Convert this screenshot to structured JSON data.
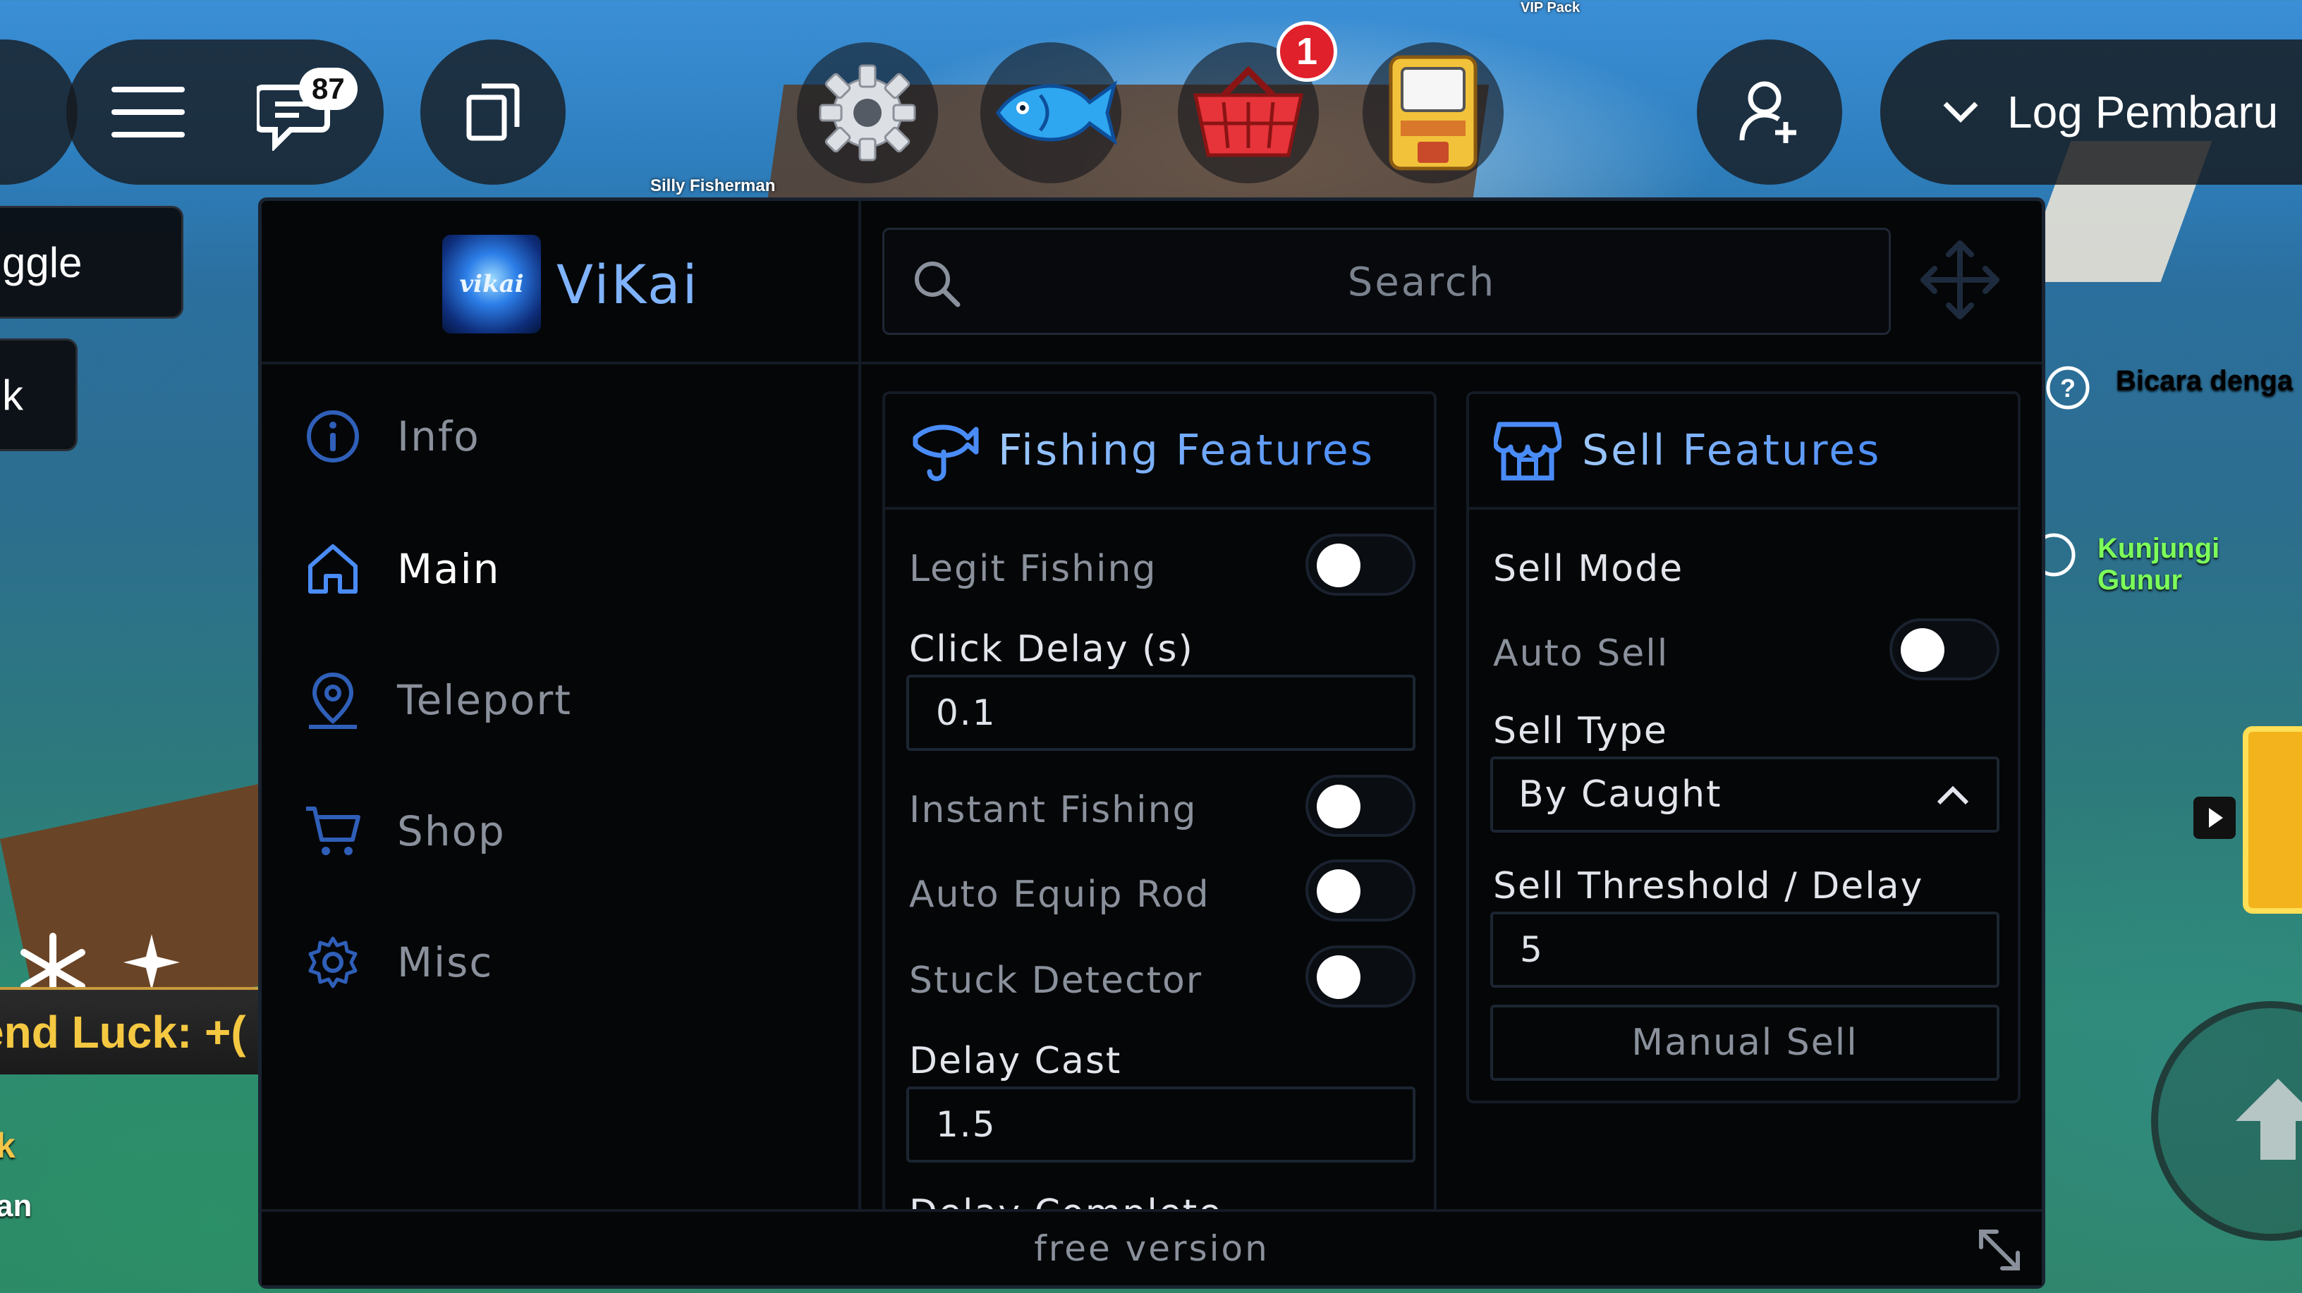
{
  "top_bar": {
    "chat_badge": "87",
    "shop_badge": "1",
    "log_button_label": "Log Pembaru",
    "npc_label": "Silly Fisherman",
    "vip_label": "VIP Pack"
  },
  "left_side": {
    "toggle_fragment": "ggle",
    "second_fragment": "k",
    "luck_text": "end Luck: +(",
    "frag_1": "k",
    "frag_2": "an"
  },
  "right_side": {
    "hint_1": "Bicara denga",
    "hint_2": "Kunjungi Gunur",
    "hint_1_color": "#ffffff",
    "hint_2_color": "#7dff5a"
  },
  "panel": {
    "brand_logo_text": "vikai",
    "brand_name": "ViKai",
    "search_placeholder": "Search",
    "nav": [
      {
        "label": "Info",
        "icon": "info-icon",
        "active": false
      },
      {
        "label": "Main",
        "icon": "home-icon",
        "active": true
      },
      {
        "label": "Teleport",
        "icon": "location-pin-icon",
        "active": false
      },
      {
        "label": "Shop",
        "icon": "cart-icon",
        "active": false
      },
      {
        "label": "Misc",
        "icon": "gear-icon",
        "active": false
      }
    ],
    "fishing": {
      "title": "Fishing Features",
      "legit_fishing": {
        "label": "Legit Fishing",
        "on": false
      },
      "click_delay_label": "Click Delay (s)",
      "click_delay_value": "0.1",
      "instant_fishing": {
        "label": "Instant Fishing",
        "on": false
      },
      "auto_equip_rod": {
        "label": "Auto Equip Rod",
        "on": false
      },
      "stuck_detector": {
        "label": "Stuck Detector",
        "on": false
      },
      "delay_cast_label": "Delay Cast",
      "delay_cast_value": "1.5",
      "delay_complete_label": "Delay Complete"
    },
    "sell": {
      "title": "Sell Features",
      "sell_mode_label": "Sell Mode",
      "auto_sell": {
        "label": "Auto Sell",
        "on": false
      },
      "sell_type_label": "Sell Type",
      "sell_type_value": "By Caught",
      "threshold_label": "Sell Threshold / Delay",
      "threshold_value": "5",
      "manual_sell_label": "Manual Sell"
    },
    "footer": "free version",
    "accent_color": "#4a8cf7"
  }
}
